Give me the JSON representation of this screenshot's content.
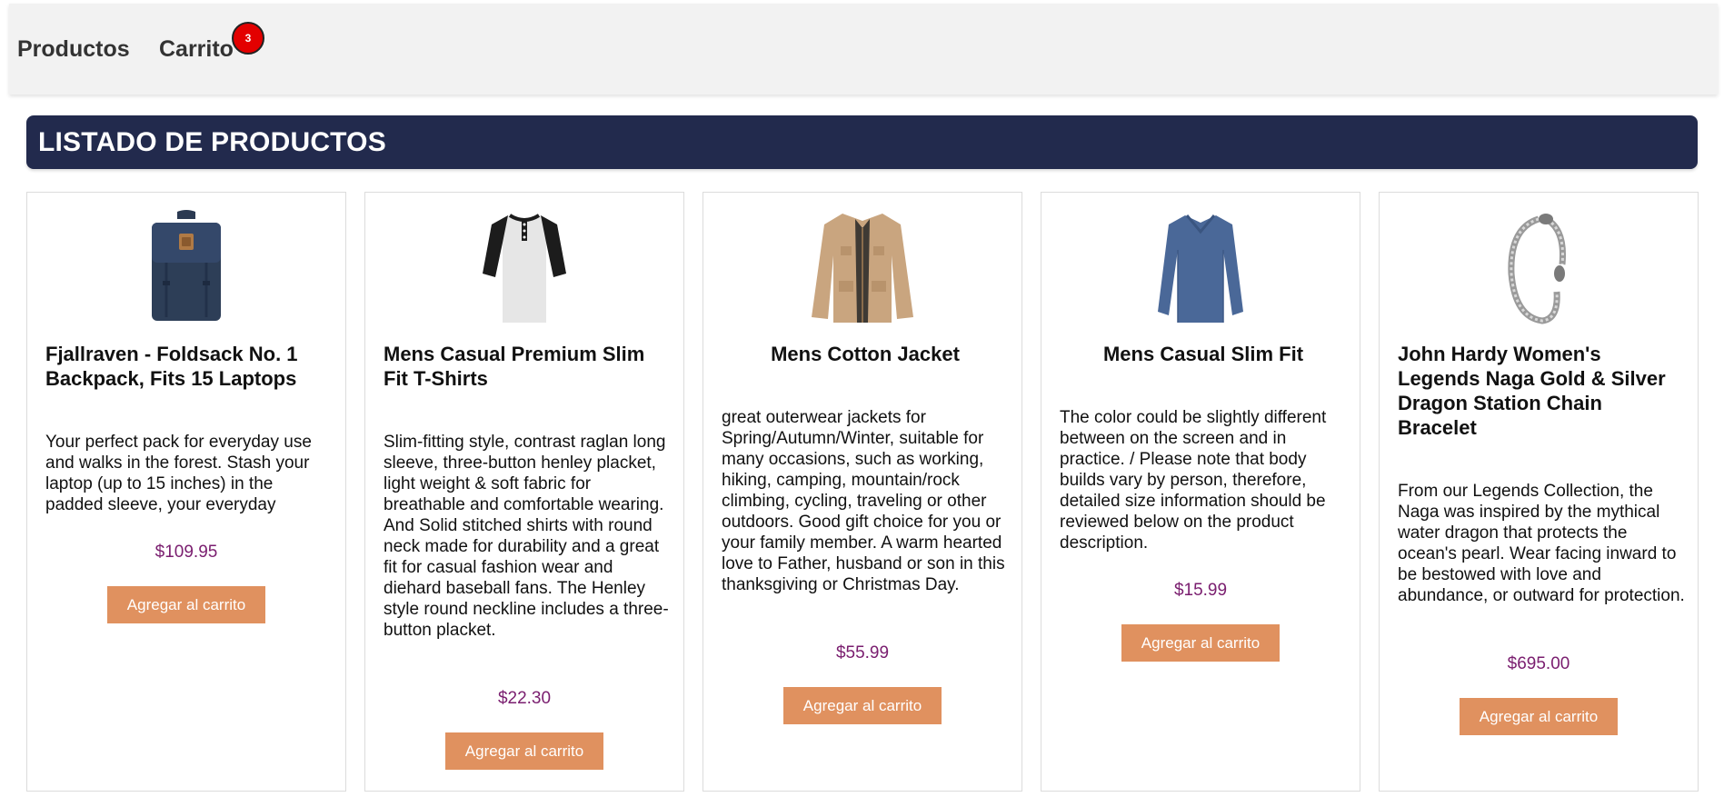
{
  "nav": {
    "products_label": "Productos",
    "cart_label": "Carrito",
    "cart_count": "3"
  },
  "header": {
    "title": "LISTADO DE PRODUCTOS"
  },
  "products": [
    {
      "title": "Fjallraven - Foldsack No. 1 Backpack, Fits 15 Laptops",
      "description": "Your perfect pack for everyday use and walks in the forest. Stash your laptop (up to 15 inches) in the padded sleeve, your everyday",
      "price": "$109.95",
      "button": "Agregar al carrito",
      "image": "backpack"
    },
    {
      "title": "Mens Casual Premium Slim Fit T-Shirts",
      "description": "Slim-fitting style, contrast raglan long sleeve, three-button henley placket, light weight & soft fabric for breathable and comfortable wearing. And Solid stitched shirts with round neck made for durability and a great fit for casual fashion wear and diehard baseball fans. The Henley style round neckline includes a three-button placket.",
      "price": "$22.30",
      "button": "Agregar al carrito",
      "image": "henley-shirt"
    },
    {
      "title": "Mens Cotton Jacket",
      "description": "great outerwear jackets for Spring/Autumn/Winter, suitable for many occasions, such as working, hiking, camping, mountain/rock climbing, cycling, traveling or other outdoors. Good gift choice for you or your family member. A warm hearted love to Father, husband or son in this thanksgiving or Christmas Day.",
      "price": "$55.99",
      "button": "Agregar al carrito",
      "image": "jacket"
    },
    {
      "title": "Mens Casual Slim Fit",
      "description": "The color could be slightly different between on the screen and in practice. / Please note that body builds vary by person, therefore, detailed size information should be reviewed below on the product description.",
      "price": "$15.99",
      "button": "Agregar al carrito",
      "image": "long-sleeve-shirt"
    },
    {
      "title": "John Hardy Women's Legends Naga Gold & Silver Dragon Station Chain Bracelet",
      "description": "From our Legends Collection, the Naga was inspired by the mythical water dragon that protects the ocean's pearl. Wear facing inward to be bestowed with love and abundance, or outward for protection.",
      "price": "$695.00",
      "button": "Agregar al carrito",
      "image": "bracelet"
    }
  ],
  "colors": {
    "navbar_bg": "#f2f2f2",
    "title_bar_bg": "#222a4d",
    "price": "#7a1e6f",
    "button_bg": "#e0915f",
    "badge": "#e30000"
  }
}
